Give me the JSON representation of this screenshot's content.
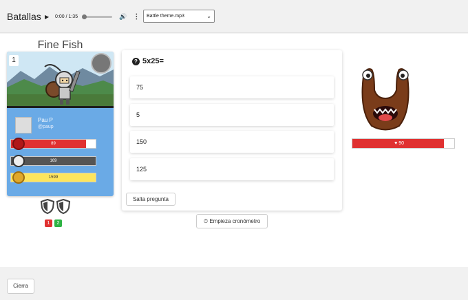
{
  "header": {
    "title": "Batallas",
    "audio": {
      "time": "0:00 / 1:35",
      "progress": 0
    },
    "track_select": {
      "value": "Battle theme.mp3"
    }
  },
  "player": {
    "hero_name": "Fine Fish",
    "level": "1",
    "user": {
      "name": "Pau P",
      "handle": "@paup"
    },
    "stats": {
      "hp": {
        "value": "89",
        "fraction": 0.89
      },
      "xp": {
        "value": "169",
        "fraction": 1
      },
      "gold": {
        "value": "1599",
        "fraction": 1
      }
    },
    "shields": 2,
    "scores": {
      "wrong": "1",
      "right": "2"
    }
  },
  "question": {
    "text": "5x25=",
    "answers": [
      "75",
      "5",
      "150",
      "125"
    ],
    "skip_label": "Salta pregunta"
  },
  "timer_label": "Empieza cronómetro",
  "monster": {
    "hp": "90",
    "hp_fraction": 0.9
  },
  "footer": {
    "close_label": "Cierra"
  },
  "colors": {
    "hp": "#e03131",
    "gold": "#fde55c",
    "card": "#6aaae6"
  }
}
